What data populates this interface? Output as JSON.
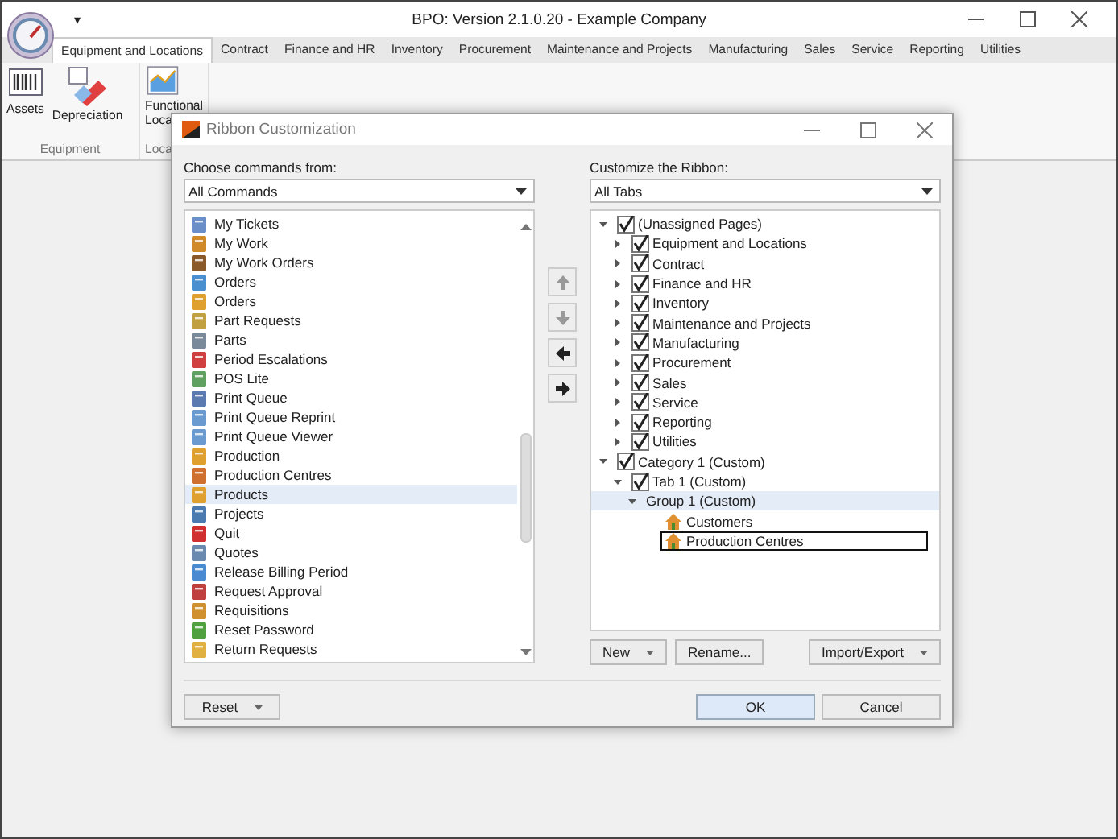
{
  "window": {
    "title": "BPO: Version 2.1.0.20 - Example Company",
    "quick_access": "▾"
  },
  "tabs": [
    {
      "label": "Equipment and Locations",
      "selected": true
    },
    {
      "label": "Contract",
      "selected": false
    },
    {
      "label": "Finance and HR",
      "selected": false
    },
    {
      "label": "Inventory",
      "selected": false
    },
    {
      "label": "Procurement",
      "selected": false
    },
    {
      "label": "Maintenance and Projects",
      "selected": false
    },
    {
      "label": "Manufacturing",
      "selected": false
    },
    {
      "label": "Sales",
      "selected": false
    },
    {
      "label": "Service",
      "selected": false
    },
    {
      "label": "Reporting",
      "selected": false
    },
    {
      "label": "Utilities",
      "selected": false
    }
  ],
  "ribbon_groups": [
    {
      "label": "Equipment",
      "buttons": [
        {
          "label": "Assets",
          "kind": "barcode"
        },
        {
          "label": "Depreciation",
          "kind": "eraser"
        }
      ]
    },
    {
      "label": "Loca",
      "buttons": [
        {
          "label": "Functional Loca",
          "kind": "chart"
        }
      ]
    }
  ],
  "dialog": {
    "title": "Ribbon Customization",
    "left": {
      "label": "Choose commands from:",
      "combo": "All Commands",
      "items": [
        {
          "label": "My Tickets",
          "selected": false
        },
        {
          "label": "My Work",
          "selected": false
        },
        {
          "label": "My Work Orders",
          "selected": false
        },
        {
          "label": "Orders",
          "selected": false
        },
        {
          "label": "Orders",
          "selected": false
        },
        {
          "label": "Part Requests",
          "selected": false
        },
        {
          "label": "Parts",
          "selected": false
        },
        {
          "label": "Period Escalations",
          "selected": false
        },
        {
          "label": "POS Lite",
          "selected": false
        },
        {
          "label": "Print Queue",
          "selected": false
        },
        {
          "label": "Print Queue Reprint",
          "selected": false
        },
        {
          "label": "Print Queue Viewer",
          "selected": false
        },
        {
          "label": "Production",
          "selected": false
        },
        {
          "label": "Production Centres",
          "selected": false
        },
        {
          "label": "Products",
          "selected": true
        },
        {
          "label": "Projects",
          "selected": false
        },
        {
          "label": "Quit",
          "selected": false
        },
        {
          "label": "Quotes",
          "selected": false
        },
        {
          "label": "Release Billing Period",
          "selected": false
        },
        {
          "label": "Request Approval",
          "selected": false
        },
        {
          "label": "Requisitions",
          "selected": false
        },
        {
          "label": "Reset Password",
          "selected": false
        },
        {
          "label": "Return Requests",
          "selected": false
        }
      ]
    },
    "move_buttons": [
      {
        "kind": "up",
        "disabled": true
      },
      {
        "kind": "down",
        "disabled": true
      },
      {
        "kind": "left",
        "disabled": false
      },
      {
        "kind": "right",
        "disabled": false
      }
    ],
    "right": {
      "label": "Customize the Ribbon:",
      "combo": "All Tabs",
      "tree": [
        {
          "label": "(Unassigned Pages)",
          "kind": "page",
          "checked": true,
          "expanded": true,
          "selected": false,
          "children": [
            {
              "label": "Equipment and Locations",
              "kind": "page",
              "checked": true,
              "expanded": false,
              "selected": false
            },
            {
              "label": "Contract",
              "kind": "page",
              "checked": true,
              "expanded": false,
              "selected": false
            },
            {
              "label": "Finance and HR",
              "kind": "page",
              "checked": true,
              "expanded": false,
              "selected": false
            },
            {
              "label": "Inventory",
              "kind": "page",
              "checked": true,
              "expanded": false,
              "selected": false
            },
            {
              "label": "Maintenance and Projects",
              "kind": "page",
              "checked": true,
              "expanded": false,
              "selected": false
            },
            {
              "label": "Manufacturing",
              "kind": "page",
              "checked": true,
              "expanded": false,
              "selected": false
            },
            {
              "label": "Procurement",
              "kind": "page",
              "checked": true,
              "expanded": false,
              "selected": false
            },
            {
              "label": "Sales",
              "kind": "page",
              "checked": true,
              "expanded": false,
              "selected": false
            },
            {
              "label": "Service",
              "kind": "page",
              "checked": true,
              "expanded": false,
              "selected": false
            },
            {
              "label": "Reporting",
              "kind": "page",
              "checked": true,
              "expanded": false,
              "selected": false
            },
            {
              "label": "Utilities",
              "kind": "page",
              "checked": true,
              "expanded": false,
              "selected": false
            }
          ]
        },
        {
          "label": "Category 1 (Custom)",
          "kind": "page",
          "checked": true,
          "expanded": true,
          "selected": false,
          "children": [
            {
              "label": "Tab 1 (Custom)",
              "kind": "page",
              "checked": true,
              "expanded": true,
              "selected": false,
              "children": [
                {
                  "label": "Group 1 (Custom)",
                  "kind": "group",
                  "expanded": true,
                  "selected": true,
                  "children": [
                    {
                      "label": "Customers",
                      "kind": "command",
                      "selected": false,
                      "focused": false
                    },
                    {
                      "label": "Production Centres",
                      "kind": "command",
                      "selected": false,
                      "focused": true
                    }
                  ]
                }
              ]
            }
          ]
        }
      ],
      "buttons": [
        {
          "label": "New",
          "dropdown": true
        },
        {
          "label": "Rename...",
          "dropdown": false
        },
        {
          "label": "Import/Export",
          "dropdown": true
        }
      ]
    },
    "reset_button": {
      "label": "Reset",
      "dropdown": true
    },
    "ok_button": "OK",
    "cancel_button": "Cancel"
  }
}
